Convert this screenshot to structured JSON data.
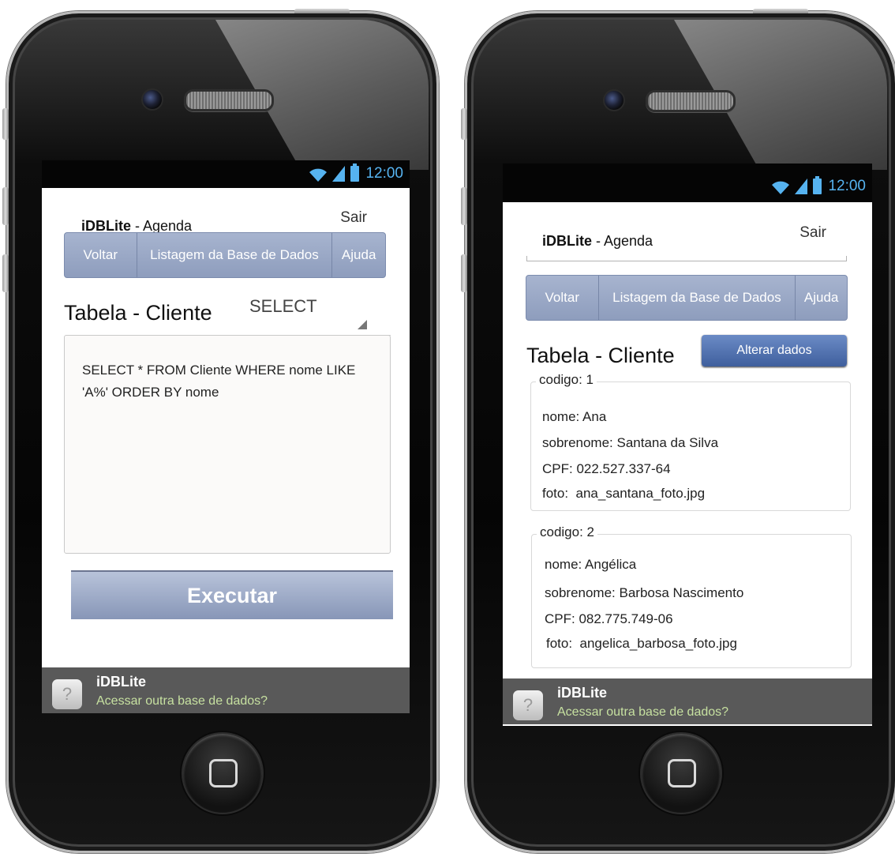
{
  "status": {
    "time": "12:00"
  },
  "app": {
    "title_bold": "iDBLite",
    "title_rest": " - Agenda",
    "exit_label": "Sair"
  },
  "nav": {
    "back": "Voltar",
    "list": "Listagem da Base de Dados",
    "help": "Ajuda"
  },
  "left_screen": {
    "section_title": "Tabela - Cliente",
    "select_value": "SELECT",
    "query_text": "SELECT * FROM Cliente WHERE nome LIKE 'A%' ORDER BY nome",
    "execute_label": "Executar"
  },
  "right_screen": {
    "section_title": "Tabela - Cliente",
    "alter_label": "Alterar dados",
    "records": [
      {
        "codigo": "codigo: 1",
        "nome": "nome: Ana",
        "sobrenome": "sobrenome: Santana da Silva",
        "cpf": "CPF: 022.527.337-64",
        "foto": "foto:  ana_santana_foto.jpg"
      },
      {
        "codigo": "codigo: 2",
        "nome": "nome: Angélica",
        "sobrenome": "sobrenome: Barbosa Nascimento",
        "cpf": "CPF: 082.775.749-06",
        "foto": "foto:  angelica_barbosa_foto.jpg"
      }
    ]
  },
  "footer": {
    "title": "iDBLite",
    "link": "Acessar outra base de dados?",
    "help_glyph": "?"
  },
  "colors": {
    "nav_bg": "#99a8c6",
    "status_accent": "#56b3f0",
    "alter_button": "#4f6fae",
    "footer_bg": "#595959",
    "footer_link": "#c6e0a0"
  }
}
